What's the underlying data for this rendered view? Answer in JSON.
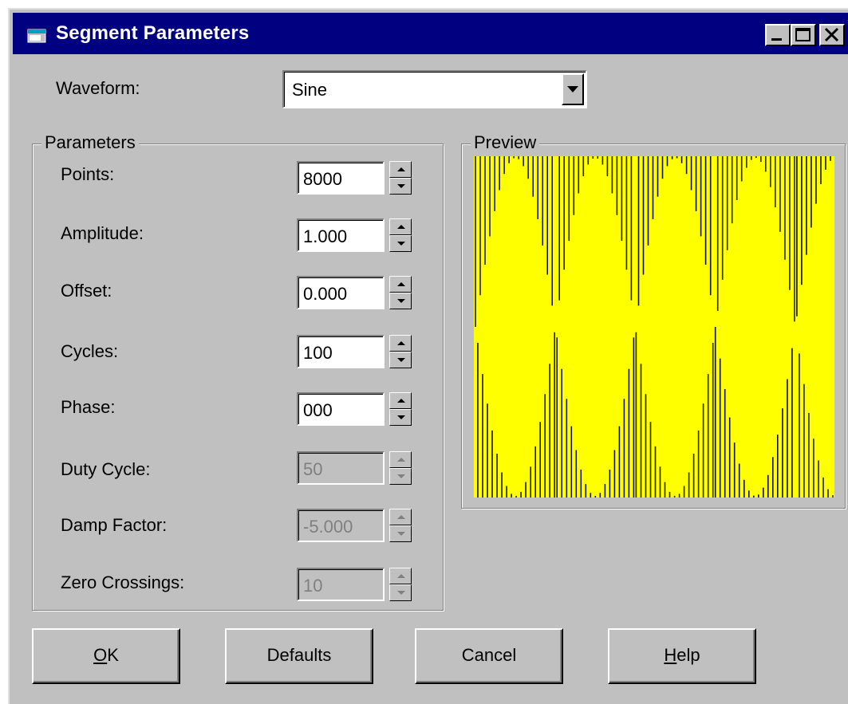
{
  "window": {
    "title": "Segment Parameters"
  },
  "waveform": {
    "label": "Waveform:",
    "value": "Sine"
  },
  "parameters": {
    "title": "Parameters",
    "fields": [
      {
        "label": "Points:",
        "value": "8000"
      },
      {
        "label": "Amplitude:",
        "value": "1.000"
      },
      {
        "label": "Offset:",
        "value": "0.000"
      },
      {
        "label": "Cycles:",
        "value": "100"
      },
      {
        "label": "Phase:",
        "value": "000"
      },
      {
        "label": "Duty Cycle:",
        "value": "50"
      },
      {
        "label": "Damp Factor:",
        "value": "-5.000"
      },
      {
        "label": "Zero Crossings:",
        "value": "10"
      }
    ]
  },
  "preview": {
    "title": "Preview"
  },
  "buttons": {
    "ok_access": "O",
    "ok_rest": "K",
    "defaults": "Defaults",
    "cancel": "Cancel",
    "help_access": "H",
    "help_rest": "elp"
  },
  "colors": {
    "titlebar": "#000080",
    "preview_bg": "#ffff00",
    "face": "#c0c0c0"
  }
}
